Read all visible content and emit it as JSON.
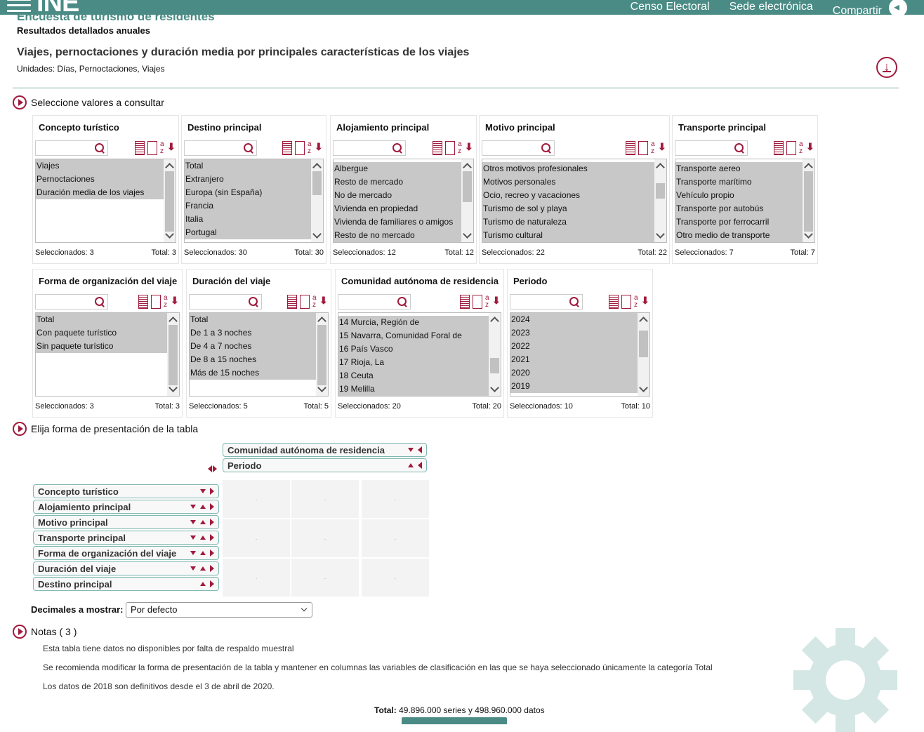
{
  "header": {
    "logo": "INE",
    "links": [
      "Censo Electoral",
      "Sede electrónica",
      "Compartir"
    ]
  },
  "survey_title": "Encuesta de turismo de residentes",
  "subtitle": "Resultados detallados anuales",
  "table_title": "Viajes, pernoctaciones y duración media por principales características de los viajes",
  "units": "Unidades:  Días, Pernoctaciones, Viajes",
  "section_select": "Seleccione valores a consultar",
  "section_layout": "Elija forma de presentación de la tabla",
  "selected_label": "Seleccionados:",
  "total_label": "Total:",
  "panels": [
    {
      "title": "Concepto turístico",
      "items": [
        "Viajes",
        "Pernoctaciones",
        "Duración media de los viajes"
      ],
      "selected": "Seleccionados: 3",
      "total": "Total: 3"
    },
    {
      "title": "Destino principal",
      "items": [
        "Total",
        "Extranjero",
        "Europa (sin España)",
        "Francia",
        "Italia",
        "Portugal"
      ],
      "selected": "Seleccionados: 30",
      "total": "Total: 30"
    },
    {
      "title": "Alojamiento principal",
      "items": [
        "Albergue",
        "Resto de mercado",
        "No de mercado",
        "Vivienda en propiedad",
        "Vivienda de familiares o amigos",
        "Resto de no mercado"
      ],
      "selected": "Seleccionados: 12",
      "total": "Total: 12"
    },
    {
      "title": "Motivo principal",
      "items": [
        "Otros motivos profesionales",
        "Motivos personales",
        "Ocio, recreo y vacaciones",
        "Turismo de sol y playa",
        "Turismo de naturaleza",
        "Turismo cultural"
      ],
      "selected": "Seleccionados: 22",
      "total": "Total: 22"
    },
    {
      "title": "Transporte principal",
      "items": [
        "Transporte aereo",
        "Transporte marítimo",
        "Vehículo propio",
        "Transporte por autobús",
        "Transporte por ferrocarril",
        "Otro medio de transporte"
      ],
      "selected": "Seleccionados: 7",
      "total": "Total: 7"
    },
    {
      "title": "Forma de organización del viaje",
      "items": [
        "Total",
        "Con paquete turístico",
        "Sin paquete turístico"
      ],
      "selected": "Seleccionados: 3",
      "total": "Total: 3"
    },
    {
      "title": "Duración del viaje",
      "items": [
        "Total",
        "De 1 a 3 noches",
        "De 4 a 7 noches",
        "De 8 a 15 noches",
        "Más de 15 noches"
      ],
      "selected": "Seleccionados: 5",
      "total": "Total: 5"
    },
    {
      "title": "Comunidad autónoma de residencia",
      "items": [
        "14 Murcia, Región de",
        "15 Navarra, Comunidad Foral de",
        "16 País Vasco",
        "17 Rioja, La",
        "18 Ceuta",
        "19 Melilla"
      ],
      "selected": "Seleccionados: 20",
      "total": "Total: 20"
    },
    {
      "title": "Periodo",
      "items": [
        "2024",
        "2023",
        "2022",
        "2021",
        "2020",
        "2019"
      ],
      "selected": "Seleccionados: 10",
      "total": "Total: 10"
    }
  ],
  "layout": {
    "columns": [
      "Comunidad autónoma de residencia",
      "Periodo"
    ],
    "rows": [
      "Concepto turístico",
      "Alojamiento principal",
      "Motivo principal",
      "Transporte principal",
      "Forma de organización del viaje",
      "Duración del viaje",
      "Destino principal"
    ],
    "cell_placeholder": "."
  },
  "decimals": {
    "label": "Decimales a mostrar:",
    "value": "Por defecto"
  },
  "notes": {
    "title": "Notas ( 3 )",
    "items": [
      "Esta tabla tiene datos no disponibles por falta de respaldo muestral",
      "Se recomienda modificar la forma de presentación de la tabla y mantener en columnas las variables de clasificación en las que se haya seleccionado únicamente la categoría Total",
      "Los datos de 2018 son definitivos desde el 3 de abril de 2020."
    ]
  },
  "totals": {
    "label": "Total:",
    "series": "49.896.000",
    "series_suffix": "series y",
    "data": "498.960.000",
    "data_suffix": "datos"
  },
  "colors": {
    "brand": "#4a8b85",
    "accent": "#a01a3c",
    "selected_item": "#c8c8c8"
  }
}
